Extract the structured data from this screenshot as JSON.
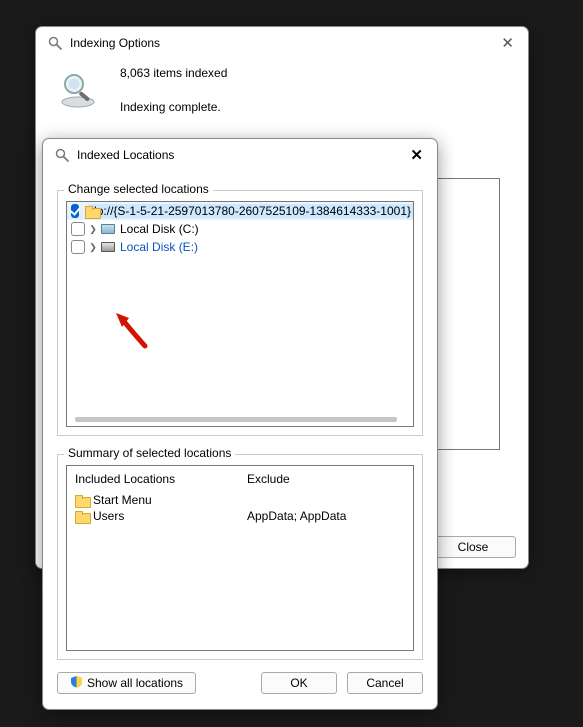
{
  "parent": {
    "title": "Indexing Options",
    "items_indexed": "8,063 items indexed",
    "indexing_status": "Indexing complete.",
    "close_label": "Close"
  },
  "child": {
    "title": "Indexed Locations",
    "change_legend": "Change selected locations",
    "rows": [
      {
        "checked": true,
        "expandable": false,
        "icon": "folder",
        "label": "dp://{S-1-5-21-2597013780-2607525109-1384614333-1001}"
      },
      {
        "checked": false,
        "expandable": true,
        "icon": "ssd",
        "label": "Local Disk (C:)"
      },
      {
        "checked": false,
        "expandable": true,
        "icon": "hdd",
        "label": "Local Disk (E:)"
      }
    ],
    "summary_legend": "Summary of selected locations",
    "summary_headers": {
      "included": "Included Locations",
      "exclude": "Exclude"
    },
    "summary_rows": [
      {
        "name": "Start Menu",
        "exclude": ""
      },
      {
        "name": "Users",
        "exclude": "AppData; AppData"
      }
    ],
    "show_all_label": "Show all locations",
    "ok_label": "OK",
    "cancel_label": "Cancel"
  }
}
